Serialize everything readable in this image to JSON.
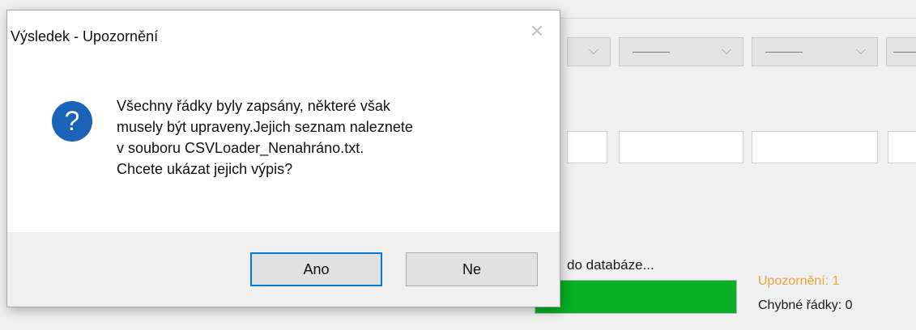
{
  "background_window": {
    "status_text": "do databáze...",
    "progress": {
      "fraction": 1.0,
      "color": "#06b025"
    },
    "warning_label": "Upozornění: 1",
    "error_rows_label": "Chybné řádky: 0",
    "combo_icon": "chevron-down-icon",
    "combo_placeholder": "———"
  },
  "dialog": {
    "title": "Výsledek - Upozornění",
    "close_icon": "close-icon",
    "question_icon_glyph": "?",
    "message_lines": [
      "Všechny řádky byly zapsány, některé však",
      "musely být upraveny.Jejich seznam naleznete",
      "v souboru CSVLoader_Nenahráno.txt.",
      "Chcete ukázat jejich výpis?"
    ],
    "buttons": {
      "yes": "Ano",
      "no": "Ne"
    }
  },
  "colors": {
    "accent": "#0078d7",
    "icon_blue": "#1a63b8",
    "warning": "#e8a33a"
  }
}
